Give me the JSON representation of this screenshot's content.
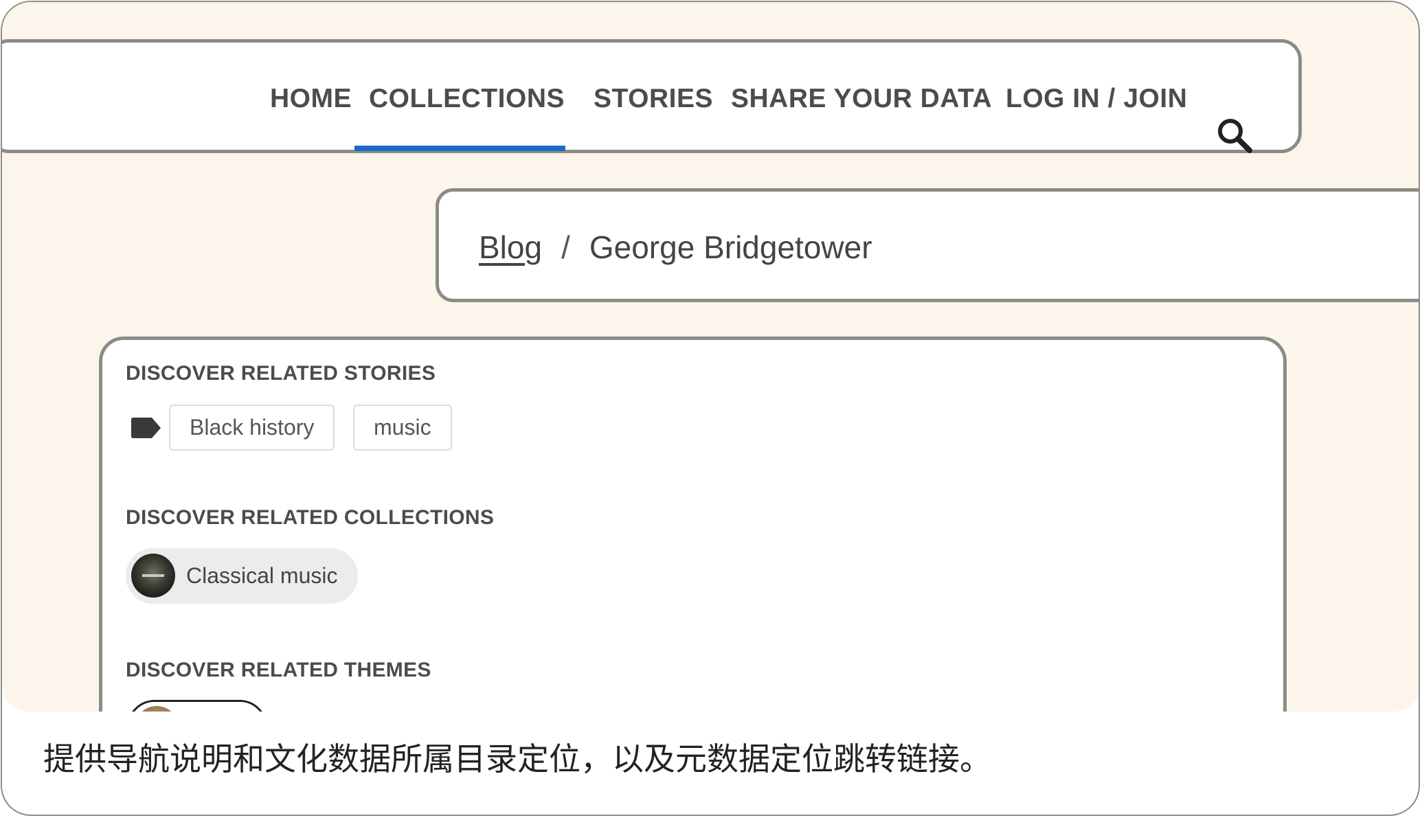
{
  "nav": {
    "items": [
      "HOME",
      "COLLECTIONS",
      "STORIES",
      "SHARE YOUR DATA",
      "LOG IN / JOIN"
    ],
    "active": "COLLECTIONS",
    "accent_color": "#1c6bc7"
  },
  "breadcrumb": {
    "link": "Blog",
    "separator": "/",
    "current": "George Bridgetower"
  },
  "related": {
    "stories_title": "DISCOVER RELATED STORIES",
    "tags": [
      "Black history",
      "music"
    ],
    "collections_title": "DISCOVER RELATED COLLECTIONS",
    "collection": "Classical music",
    "themes_title": "DISCOVER RELATED THEMES"
  },
  "caption": "提供导航说明和文化数据所属目录定位，以及元数据定位跳转链接。",
  "icons": [
    "search-icon",
    "tag-icon"
  ]
}
